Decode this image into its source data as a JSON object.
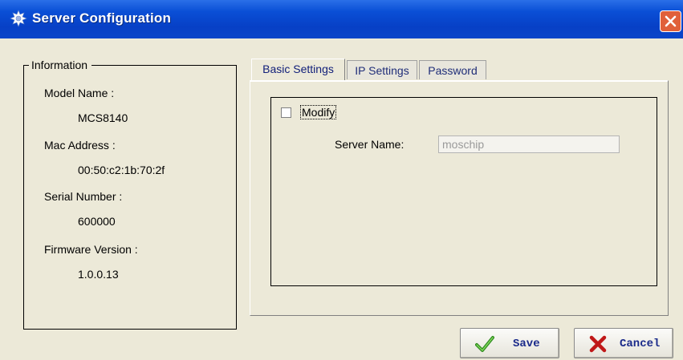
{
  "window": {
    "title": "Server Configuration",
    "title_icon": "gear-icon",
    "close_icon": "close-icon"
  },
  "information": {
    "legend": "Information",
    "model_name_label": "Model Name :",
    "model_name_value": "MCS8140",
    "mac_address_label": "Mac Address :",
    "mac_address_value": "00:50:c2:1b:70:2f",
    "serial_number_label": "Serial Number :",
    "serial_number_value": "600000",
    "firmware_version_label": "Firmware Version :",
    "firmware_version_value": "1.0.0.13"
  },
  "tabs": [
    {
      "label": "Basic Settings",
      "active": true
    },
    {
      "label": "IP Settings",
      "active": false
    },
    {
      "label": "Password",
      "active": false
    }
  ],
  "basic_settings": {
    "modify_label": "Modify",
    "modify_checked": false,
    "server_name_label": "Server Name:",
    "server_name_value": "moschip"
  },
  "buttons": {
    "save_label": "Save",
    "save_icon": "checkmark-icon",
    "cancel_label": "Cancel",
    "cancel_icon": "x-mark-icon"
  },
  "colors": {
    "titlebar": "#0a4fd6",
    "window_bg": "#ece9d8",
    "close_button": "#e0603a",
    "button_text": "#1a2a8a",
    "save_check": "#2e8a1e",
    "cancel_x": "#c01818"
  }
}
